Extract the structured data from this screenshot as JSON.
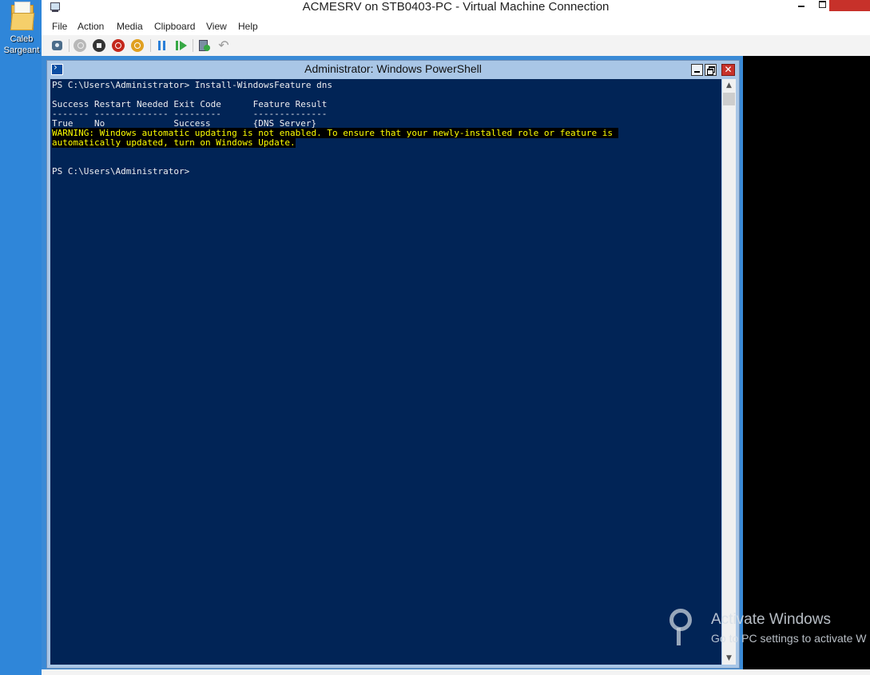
{
  "desktop": {
    "icon_label": "Caleb Sargeant"
  },
  "vm_window": {
    "title": "ACMESRV on STB0403-PC - Virtual Machine Connection",
    "menu": [
      "File",
      "Action",
      "Media",
      "Clipboard",
      "View",
      "Help"
    ]
  },
  "powershell": {
    "title": "Administrator: Windows PowerShell",
    "lines": [
      {
        "text": "PS C:\\Users\\Administrator> Install-WindowsFeature dns",
        "style": "normal"
      },
      {
        "text": "",
        "style": "normal"
      },
      {
        "text": "Success Restart Needed Exit Code      Feature Result",
        "style": "normal"
      },
      {
        "text": "------- -------------- ---------      --------------",
        "style": "normal"
      },
      {
        "text": "True    No             Success        {DNS Server}",
        "style": "normal"
      },
      {
        "text": "WARNING: Windows automatic updating is not enabled. To ensure that your newly-installed role or feature is ",
        "style": "warning"
      },
      {
        "text": "automatically updated, turn on Windows Update.",
        "style": "warning"
      },
      {
        "text": "",
        "style": "normal"
      },
      {
        "text": "",
        "style": "normal"
      },
      {
        "text": "PS C:\\Users\\Administrator>",
        "style": "normal"
      }
    ]
  },
  "watermark": {
    "title": "Activate Windows",
    "subtitle": "Go to PC settings to activate W"
  },
  "colors": {
    "console_bg": "#012456",
    "console_fg": "#eeedf0",
    "warning_fg": "#ffff00",
    "warning_bg": "#000000",
    "desktop_bg": "#3a8ad6"
  },
  "icons": [
    "folder-icon",
    "vm-connection-icon",
    "ctrl-alt-del-icon",
    "start-icon",
    "turn-off-icon",
    "shutdown-icon",
    "save-icon",
    "pause-icon",
    "reset-icon",
    "checkpoint-icon",
    "revert-icon",
    "powershell-icon",
    "key-icon"
  ]
}
